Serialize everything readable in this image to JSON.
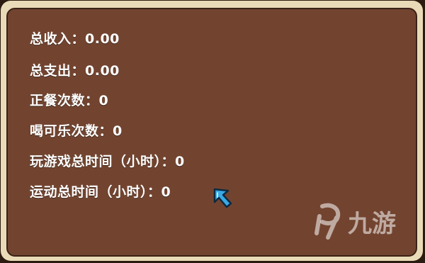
{
  "stats": [
    {
      "label": "总收入：",
      "value": "0.00"
    },
    {
      "label": "总支出：",
      "value": "0.00"
    },
    {
      "label": "正餐次数：",
      "value": "0"
    },
    {
      "label": "喝可乐次数：",
      "value": "0"
    },
    {
      "label": "玩游戏总时间（小时）：",
      "value": "0"
    },
    {
      "label": "运动总时间（小时）：",
      "value": "0"
    }
  ],
  "watermark": {
    "text": "九游"
  },
  "icons": {
    "cursor": "arrow-cursor-icon",
    "logo": "nine-game-logo-icon"
  },
  "colors": {
    "panel": "#724430",
    "border": "#eadbb8",
    "text": "#ffffff",
    "cursor": "#3aa9e6"
  }
}
